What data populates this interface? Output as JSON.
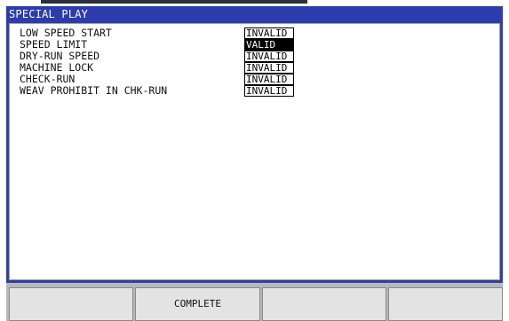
{
  "title": "SPECIAL PLAY",
  "settings": [
    {
      "label": "LOW SPEED START",
      "value": "INVALID"
    },
    {
      "label": "SPEED LIMIT",
      "value": "VALID"
    },
    {
      "label": "DRY-RUN SPEED",
      "value": "INVALID"
    },
    {
      "label": "MACHINE LOCK",
      "value": "INVALID"
    },
    {
      "label": "CHECK-RUN",
      "value": "INVALID"
    },
    {
      "label": "WEAV PROHIBIT IN CHK-RUN",
      "value": "INVALID"
    }
  ],
  "selected_setting": "SPEED LIMIT",
  "function_keys": [
    "",
    "COMPLETE",
    "",
    ""
  ],
  "colors": {
    "title_bar": "#2c3cad",
    "selection": "#000000",
    "key_face": "#e3e3e3"
  }
}
